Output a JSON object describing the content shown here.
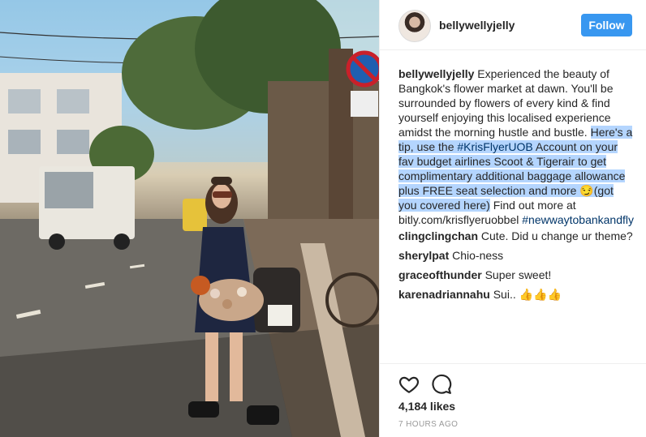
{
  "post": {
    "image_alt": "Woman in navy dress holding flowers on a Bangkok street",
    "username": "bellywellyjelly",
    "follow_label": "Follow",
    "caption": {
      "user": "bellywellyjelly",
      "text_a": " Experienced the beauty of Bangkok's flower market at dawn. You'll be surrounded by flowers of every kind & find yourself enjoying this localised experience amidst the morning hustle and bustle. ",
      "hl_a": "Here's a tip, use the ",
      "hl_tag": "#KrisFlyerUOB",
      "hl_b": " Account on your fav budget airlines Scoot & Tigerair to get complimentary additional baggage allowance plus FREE seat selection and more 😏(got you covered here)",
      "text_b": " Find out more at bitly.com/krisflyeruobbel ",
      "tag2": "#newwaytobankandfly"
    },
    "comments": [
      {
        "user": "clingclingchan",
        "text": " Cute. Did u change ur theme?"
      },
      {
        "user": "sherylpat",
        "text": " Chio-ness"
      },
      {
        "user": "graceofthunder",
        "text": " Super sweet!"
      },
      {
        "user": "karenadriannahu",
        "text": " Sui.. 👍👍👍"
      }
    ],
    "likes": "4,184 likes",
    "time_ago": "7 HOURS AGO",
    "icons": {
      "like": "heart-icon",
      "comment": "comment-bubble-icon"
    }
  }
}
